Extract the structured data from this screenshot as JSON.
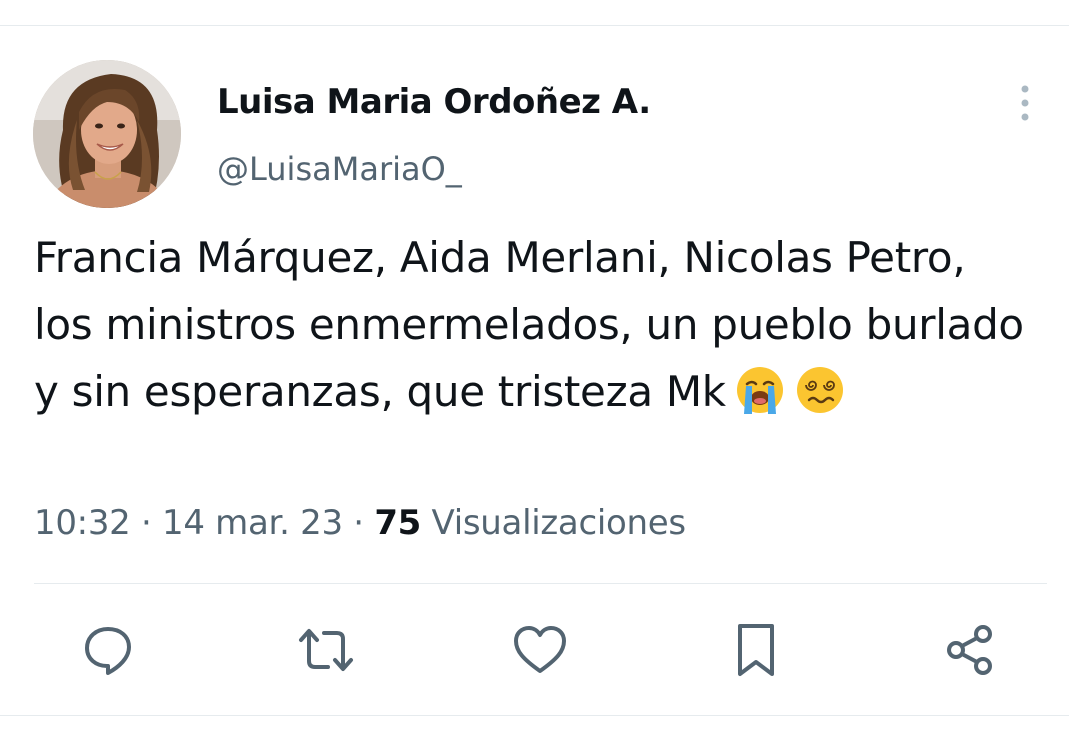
{
  "author": {
    "display_name": "Luisa Maria Ordoñez A.",
    "handle": "@LuisaMariaO_"
  },
  "tweet": {
    "text": "Francia Márquez, Aida Merlani, Nicolas Petro, los ministros enmermelados, un pueblo burlado y sin esperanzas, que tristeza Mk",
    "emojis": [
      "loudly-crying-face-emoji",
      "face-with-spiral-eyes-emoji"
    ]
  },
  "meta": {
    "time": "10:32",
    "separator_1": " · ",
    "date": "14 mar. 23",
    "separator_2": " · ",
    "views_count": "75",
    "views_label": " Visualizaciones"
  },
  "actions": [
    "reply-icon",
    "retweet-icon",
    "like-icon",
    "bookmark-icon",
    "share-icon"
  ],
  "colors": {
    "text": "#0f1419",
    "secondary": "#536471",
    "divider": "#e6ebee",
    "icon": "#536471"
  }
}
